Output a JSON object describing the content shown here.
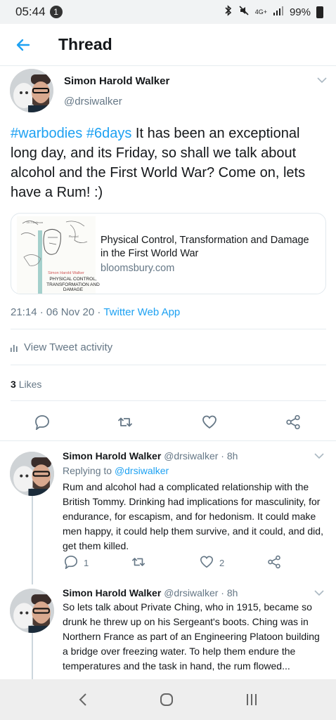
{
  "status_bar": {
    "time": "05:44",
    "notification_count": "1",
    "network": "4G+",
    "battery": "99%"
  },
  "header": {
    "title": "Thread"
  },
  "main_tweet": {
    "name": "Simon Harold Walker",
    "handle": "@drsiwalker",
    "hashtags": "#warbodies #6days",
    "text": " It has been an exceptional long day, and its Friday, so shall we talk about alcohol and the First World War?  Come on, lets have a Rum! :)",
    "card": {
      "title": "Physical Control, Transformation and Damage in the First World War",
      "domain": "bloomsbury.com",
      "thumb_author": "Simon Harold Walker",
      "thumb_title": "PHYSICAL CONTROL, TRANSFORMATION AND DAMAGE"
    },
    "timestamp": "21:14 · 06 Nov 20 · ",
    "via": "Twitter Web App",
    "activity_label": "View Tweet activity",
    "likes_count": "3",
    "likes_label": "Likes"
  },
  "replies": [
    {
      "name": "Simon Harold Walker",
      "meta": "@drsiwalker · 8h",
      "replying_label": "Replying to ",
      "replying_to": "@drsiwalker",
      "text": "Rum and alcohol had a complicated relationship with the British Tommy.  Drinking had implications for masculinity, for endurance, for escapism, and for hedonism.  It could make men happy, it could help them survive, and it could, and did, get them killed.",
      "reply_count": "1",
      "like_count": "2"
    },
    {
      "name": "Simon Harold Walker",
      "meta": "@drsiwalker · 8h",
      "text": "So lets talk about Private Ching, who in 1915, became so drunk he threw up on his Sergeant's boots.  Ching was in Northern France as part of an Engineering Platoon building a bridge over freezing water.  To help them endure the temperatures and the task in hand, the rum flowed..."
    }
  ],
  "icons": [
    "back-arrow-icon",
    "chevron-down-icon",
    "reply-icon",
    "retweet-icon",
    "like-icon",
    "share-icon",
    "bar-chart-icon",
    "nav-back-icon",
    "nav-home-icon",
    "nav-recents-icon"
  ],
  "colors": {
    "accent": "#1da1f2",
    "secondary_text": "#657786",
    "divider": "#e6ecf0"
  }
}
